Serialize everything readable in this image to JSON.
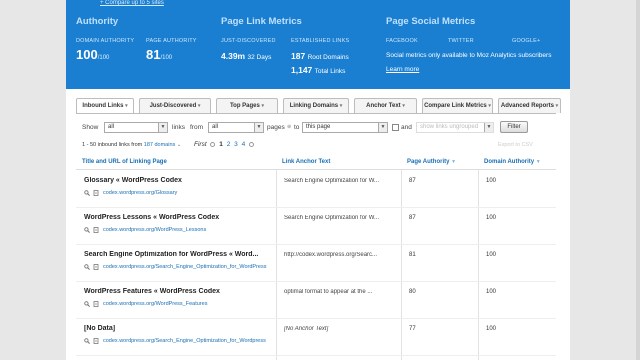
{
  "banner": {
    "compare_link": "+ Compare up to 5 sites",
    "authority": {
      "title": "Authority",
      "domain_label": "DOMAIN AUTHORITY",
      "domain_value": "100",
      "domain_max": "/100",
      "page_label": "PAGE AUTHORITY",
      "page_value": "81",
      "page_max": "/100"
    },
    "link_metrics": {
      "title": "Page Link Metrics",
      "just_label": "JUST-DISCOVERED",
      "just_value": "4.39m",
      "just_period": "32 Days",
      "est_label": "ESTABLISHED LINKS",
      "root_value": "187",
      "root_label": "Root Domains",
      "total_value": "1,147",
      "total_label": "Total Links"
    },
    "social": {
      "title": "Page Social Metrics",
      "facebook": "FACEBOOK",
      "twitter": "TWITTER",
      "google": "GOOGLE+",
      "note": "Social metrics only available to Moz Analytics subscribers",
      "learn_more": "Learn more"
    }
  },
  "tabs": [
    {
      "label": "Inbound Links",
      "active": true
    },
    {
      "label": "Just-Discovered",
      "active": false
    },
    {
      "label": "Top Pages",
      "active": false
    },
    {
      "label": "Linking Domains",
      "active": false
    },
    {
      "label": "Anchor Text",
      "active": false
    },
    {
      "label": "Compare Link Metrics",
      "active": false
    },
    {
      "label": "Advanced Reports",
      "active": false
    }
  ],
  "filters": {
    "show_label": "Show",
    "show_value": "all",
    "links_label": "links",
    "from_label": "from",
    "from_value": "all",
    "pages_label": "pages",
    "to_label": "to",
    "to_value": "this page",
    "and_label": "and",
    "group_value": "show links ungrouped",
    "filter_button": "Filter",
    "export": "Export to CSV"
  },
  "results": {
    "count_prefix": "1 - 50 inbound links from",
    "count_link": "187 domains",
    "first": "First",
    "pages": [
      "1",
      "2",
      "3",
      "4"
    ],
    "current_page": "1"
  },
  "columns": {
    "title": "Title and URL of Linking Page",
    "anchor": "Link Anchor Text",
    "pa": "Page Authority",
    "da": "Domain Authority"
  },
  "rows": [
    {
      "title": "Glossary « WordPress Codex",
      "url": "codex.wordpress.org/Glossary",
      "anchor": "Search Engine Optimization for W...",
      "pa": "87",
      "da": "100",
      "italic": false
    },
    {
      "title": "WordPress Lessons « WordPress Codex",
      "url": "codex.wordpress.org/WordPress_Lessons",
      "anchor": "Search Engine Optimization for W...",
      "pa": "87",
      "da": "100",
      "italic": false
    },
    {
      "title": "Search Engine Optimization for WordPress « Word...",
      "url": "codex.wordpress.org/Search_Engine_Optimization_for_WordPress",
      "anchor": "http://codex.wordpress.org/Searc...",
      "pa": "81",
      "da": "100",
      "italic": false
    },
    {
      "title": "WordPress Features « WordPress Codex",
      "url": "codex.wordpress.org/WordPress_Features",
      "anchor": "optimal format to appear at the ...",
      "pa": "80",
      "da": "100",
      "italic": false
    },
    {
      "title": "[No Data]",
      "url": "codex.wordpress.org/Search_Engine_Optimization_for_Wordpress",
      "anchor": "[No Anchor Text]",
      "pa": "77",
      "da": "100",
      "italic": true
    }
  ]
}
